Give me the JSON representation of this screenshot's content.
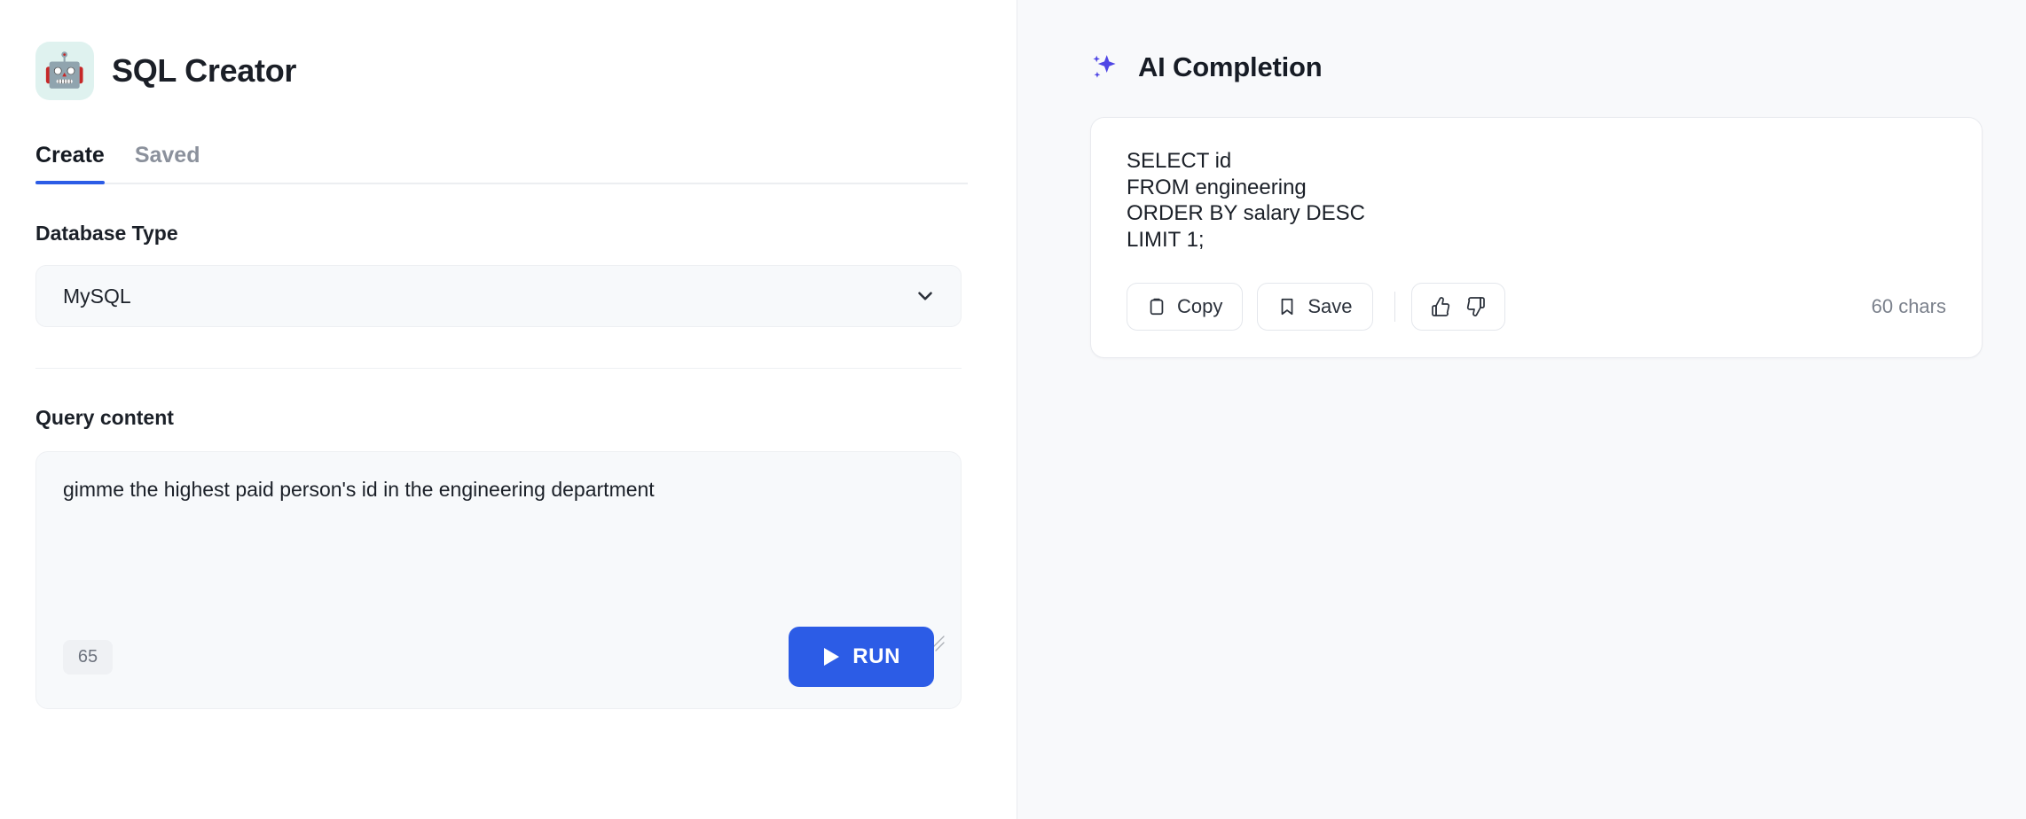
{
  "app": {
    "logo_glyph": "🤖",
    "logo_icon_name": "robot-emoji-icon",
    "title": "SQL Creator",
    "accent_color": "#2c5ce6",
    "logo_bg_color": "#dff2ef"
  },
  "tabs": [
    {
      "label": "Create",
      "active": true
    },
    {
      "label": "Saved",
      "active": false
    }
  ],
  "database_type": {
    "label": "Database Type",
    "value": "MySQL",
    "options": [
      "MySQL"
    ]
  },
  "query": {
    "label": "Query content",
    "value": "gimme the highest paid person's id in the engineering department",
    "char_count": "65",
    "run_label": "RUN"
  },
  "ai_panel": {
    "title": "AI Completion",
    "sparkle_color": "#4f46e5",
    "completion_lines": [
      "SELECT id",
      "FROM engineering",
      "ORDER BY salary DESC",
      "LIMIT 1;"
    ],
    "copy_label": "Copy",
    "save_label": "Save",
    "chars_label": "60 chars"
  }
}
